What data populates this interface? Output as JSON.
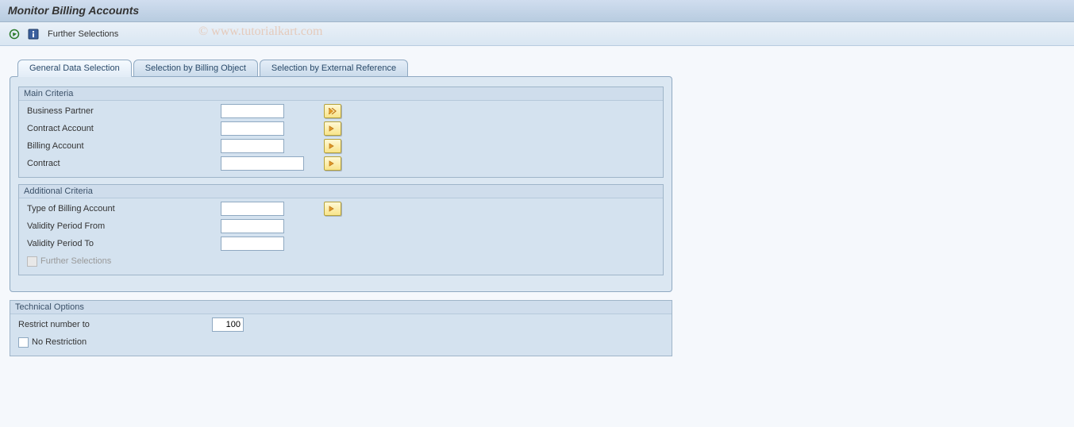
{
  "header": {
    "title": "Monitor Billing Accounts"
  },
  "toolbar": {
    "further_selections": "Further Selections",
    "watermark": "© www.tutorialkart.com"
  },
  "tabs": [
    {
      "label": "General Data Selection",
      "active": true
    },
    {
      "label": "Selection by Billing Object",
      "active": false
    },
    {
      "label": "Selection by External Reference",
      "active": false
    }
  ],
  "main_criteria": {
    "title": "Main Criteria",
    "fields": {
      "business_partner": {
        "label": "Business Partner",
        "value": ""
      },
      "contract_account": {
        "label": "Contract Account",
        "value": ""
      },
      "billing_account": {
        "label": "Billing Account",
        "value": ""
      },
      "contract": {
        "label": "Contract",
        "value": ""
      }
    }
  },
  "additional_criteria": {
    "title": "Additional Criteria",
    "fields": {
      "type_billing_account": {
        "label": "Type of Billing Account",
        "value": ""
      },
      "validity_from": {
        "label": "Validity Period From",
        "value": ""
      },
      "validity_to": {
        "label": "Validity Period To",
        "value": ""
      },
      "further_selections": {
        "label": "Further Selections"
      }
    }
  },
  "technical_options": {
    "title": "Technical Options",
    "restrict_label": "Restrict number to",
    "restrict_value": "100",
    "no_restriction_label": "No Restriction"
  }
}
